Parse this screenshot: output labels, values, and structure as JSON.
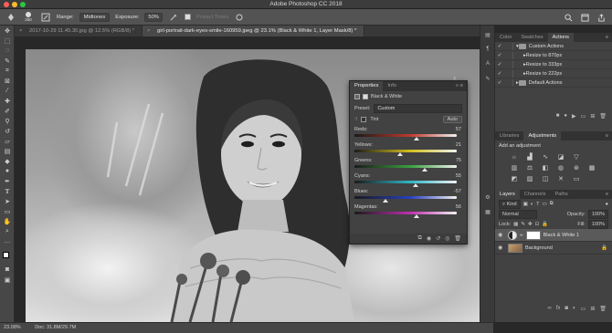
{
  "window": {
    "title": "Adobe Photoshop CC 2018"
  },
  "options": {
    "brush_size": "250",
    "range_label": "Range:",
    "range_value": "Midtones",
    "exposure_label": "Exposure:",
    "exposure_value": "50%",
    "protect_tones": "Protect Tones"
  },
  "tabs": [
    {
      "label": "2017-10-29 11.45.30.jpg @ 12.5% (RGB/8) *"
    },
    {
      "label": "girl-portrait-dark-eyes-smile-160959.jpeg @ 23.1% (Black & White 1, Layer Mask/8) *"
    }
  ],
  "status": {
    "zoom": "23.08%",
    "doc": "Doc: 31.8M/29.7M"
  },
  "properties": {
    "tabs": [
      "Properties",
      "Info"
    ],
    "layer_type": "Black & White",
    "preset_label": "Preset:",
    "preset_value": "Custom",
    "tint_label": "Tint",
    "auto_label": "Auto",
    "sliders": [
      {
        "label": "Reds:",
        "value": "57",
        "fraction": 0.61
      },
      {
        "label": "Yellows:",
        "value": "21",
        "fraction": 0.45
      },
      {
        "label": "Greens:",
        "value": "75",
        "fraction": 0.69
      },
      {
        "label": "Cyans:",
        "value": "55",
        "fraction": 0.6
      },
      {
        "label": "Blues:",
        "value": "-57",
        "fraction": 0.3
      },
      {
        "label": "Magentas:",
        "value": "56",
        "fraction": 0.61
      }
    ]
  },
  "color_panel": {
    "tabs": [
      "Color",
      "Swatches",
      "Actions"
    ]
  },
  "actions": {
    "items": [
      {
        "label": "Custom Actions",
        "level": 0
      },
      {
        "label": "Resize to 870px",
        "level": 1
      },
      {
        "label": "Resize to 333px",
        "level": 1
      },
      {
        "label": "Resize to 222px",
        "level": 1
      },
      {
        "label": "Default Actions",
        "level": 0
      }
    ]
  },
  "adjustments": {
    "tabs": [
      "Libraries",
      "Adjustments"
    ],
    "heading": "Add an adjustment"
  },
  "layers": {
    "tabs": [
      "Layers",
      "Channels",
      "Paths"
    ],
    "kind_label": "Kind",
    "blend_mode": "Normal",
    "opacity_label": "Opacity:",
    "opacity_value": "100%",
    "fill_label": "Fill:",
    "fill_value": "100%",
    "lock_label": "Lock:",
    "items": [
      {
        "name": "Black & White 1"
      },
      {
        "name": "Background"
      }
    ]
  },
  "colors": {
    "reds_bar": "#c0392b",
    "yellows_bar": "#d4c020",
    "greens_bar": "#3aa040",
    "cyans_bar": "#30b8c8",
    "blues_bar": "#2840c0",
    "magentas_bar": "#c030b0"
  }
}
